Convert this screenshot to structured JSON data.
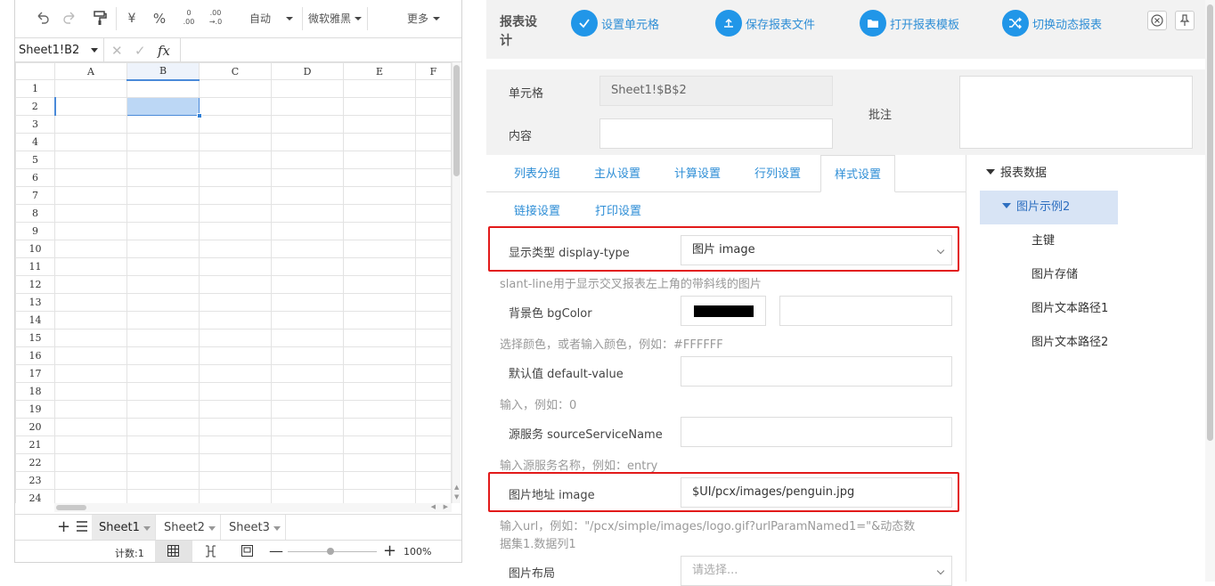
{
  "toolbar": {
    "auto_label": "自动",
    "font_label": "微软雅黑",
    "more_label": "更多",
    "currency_symbol": "¥",
    "percent_symbol": "%",
    "fx_label": "fx",
    "dec_add_top": "0",
    "dec_add_bottom": ".00",
    "dec_rm_top": ".00",
    "dec_rm_bottom": "→.0"
  },
  "formula": {
    "name_box": "Sheet1!B2"
  },
  "grid": {
    "columns": [
      "A",
      "B",
      "C",
      "D",
      "E",
      "F"
    ],
    "rows": [
      "1",
      "2",
      "3",
      "4",
      "5",
      "6",
      "7",
      "8",
      "9",
      "10",
      "11",
      "12",
      "13",
      "14",
      "15",
      "16",
      "17",
      "18",
      "19",
      "20",
      "21",
      "22",
      "23",
      "24"
    ],
    "selected_col": "B",
    "selected_row": "2"
  },
  "sheets": [
    "Sheet1",
    "Sheet2",
    "Sheet3"
  ],
  "status": {
    "count_label": "计数:1",
    "zoom": "100%"
  },
  "designer": {
    "title": "报表设计",
    "actions": [
      {
        "label": "设置单元格",
        "icon": "check-icon"
      },
      {
        "label": "保存报表文件",
        "icon": "upload-icon"
      },
      {
        "label": "打开报表模板",
        "icon": "folder-icon"
      },
      {
        "label": "切换动态报表",
        "icon": "shuffle-icon"
      }
    ],
    "cell_label": "单元格",
    "cell_value": "Sheet1!$B$2",
    "content_label": "内容",
    "content_value": "",
    "note_label": "批注",
    "note_value": ""
  },
  "tabs": [
    "列表分组",
    "主从设置",
    "计算设置",
    "行列设置",
    "样式设置",
    "链接设置",
    "打印设置"
  ],
  "active_tab": "样式设置",
  "form": {
    "display_type_label": "显示类型 display-type",
    "display_type_value": "图片 image",
    "display_type_hint": "slant-line用于显示交叉报表左上角的带斜线的图片",
    "bgcolor_label": "背景色 bgColor",
    "bgcolor_swatch": "#000000",
    "bgcolor_hint": "选择颜色，或者输入颜色，例如：#FFFFFF",
    "default_label": "默认值 default-value",
    "default_hint": "输入，例如：0",
    "source_label": "源服务 sourceServiceName",
    "source_hint": "输入源服务名称，例如：entry",
    "image_label": "图片地址 image",
    "image_value": "$UI/pcx/images/penguin.jpg",
    "image_hint_line1": "输入url，例如：\"/pcx/simple/images/logo.gif?urlParamNamed1=\"&动态数",
    "image_hint_line2": "据集1.数据列1",
    "layout_label": "图片布局",
    "layout_placeholder": "请选择..."
  },
  "tree": {
    "root": "报表数据",
    "selected": "图片示例2",
    "children": [
      "主键",
      "图片存储",
      "图片文本路径1",
      "图片文本路径2"
    ]
  },
  "colors": {
    "accent": "#2196e8",
    "highlight": "#e21a1a",
    "selection": "#bcd7f5"
  }
}
